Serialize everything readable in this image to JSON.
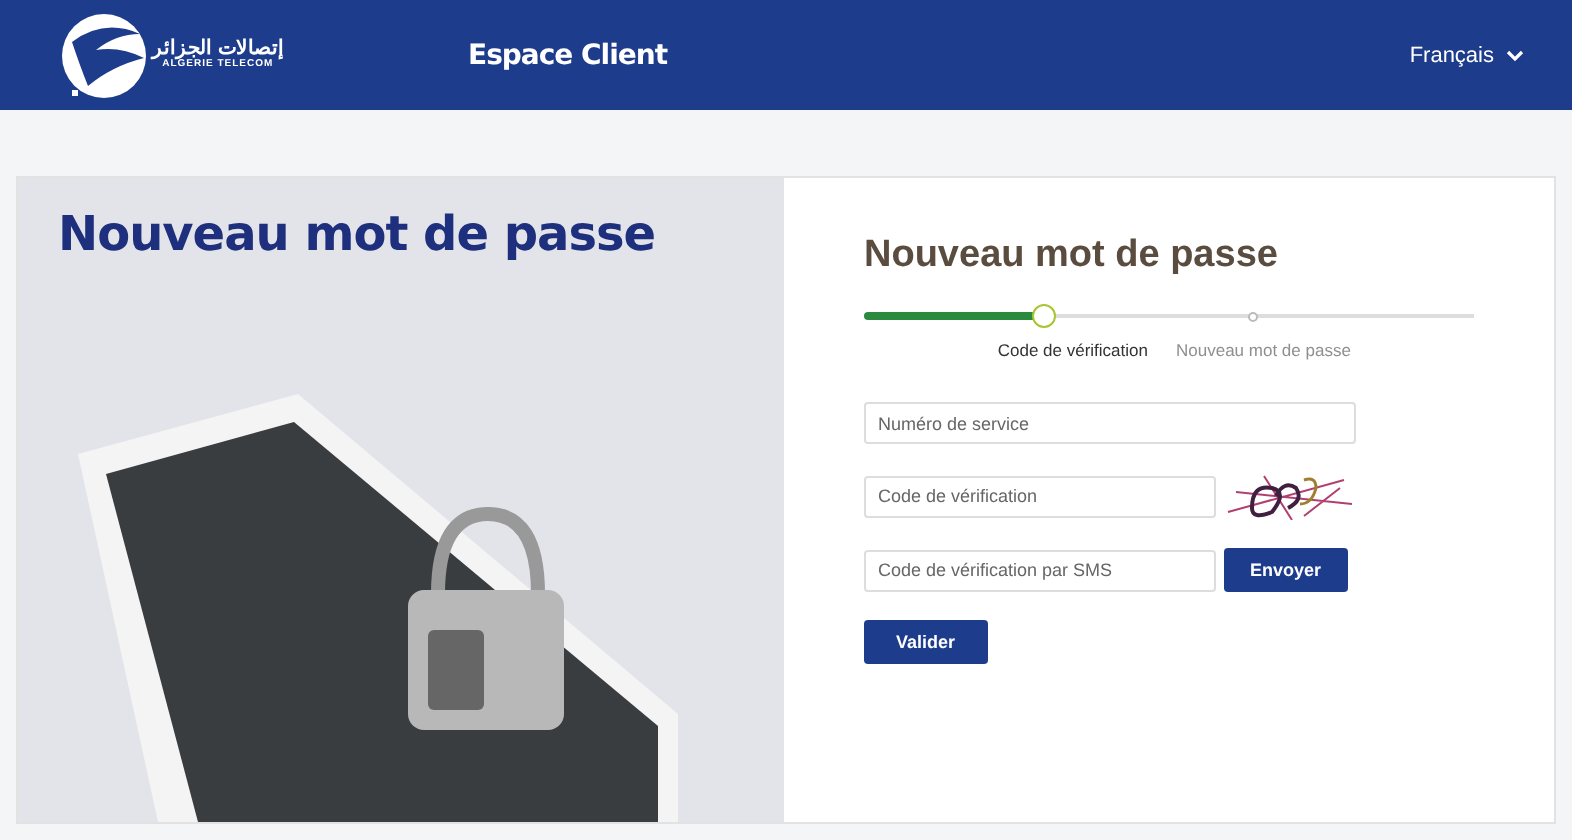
{
  "header": {
    "logo": {
      "arabic": "إتصالات الجزائر",
      "latin": "ALGERIE TELECOM"
    },
    "title": "Espace Client",
    "language": "Français"
  },
  "banner": {
    "title": "Nouveau mot de passe"
  },
  "form": {
    "title": "Nouveau mot de passe",
    "steps": [
      {
        "label": "Code de vérification",
        "selected": true
      },
      {
        "label": "Nouveau mot de passe",
        "selected": false
      }
    ],
    "fields": [
      {
        "kind": "plain",
        "placeholder": "Numéro de service"
      },
      {
        "kind": "captcha",
        "placeholder": "Code de vérification"
      },
      {
        "kind": "sms",
        "placeholder": "Code de vérification par SMS",
        "button": "Envoyer"
      }
    ],
    "submit": "Valider"
  }
}
